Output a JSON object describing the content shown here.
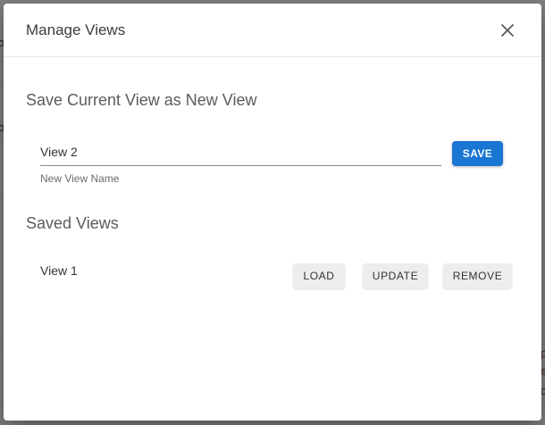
{
  "background": {
    "left_fragments": [
      "o",
      "o"
    ],
    "right_fragments": [
      "p",
      "e",
      "o"
    ]
  },
  "dialog": {
    "title": "Manage Views",
    "close_icon": "close-icon",
    "save_section": {
      "title": "Save Current View as New View",
      "input_value": "View 2",
      "input_helper": "New View Name",
      "save_label": "SAVE"
    },
    "saved_section": {
      "title": "Saved Views",
      "views": [
        {
          "name": "View 1",
          "load_label": "LOAD",
          "update_label": "UPDATE",
          "remove_label": "REMOVE"
        }
      ]
    }
  },
  "colors": {
    "primary": "#1976d2",
    "secondary_button": "#ededed"
  }
}
